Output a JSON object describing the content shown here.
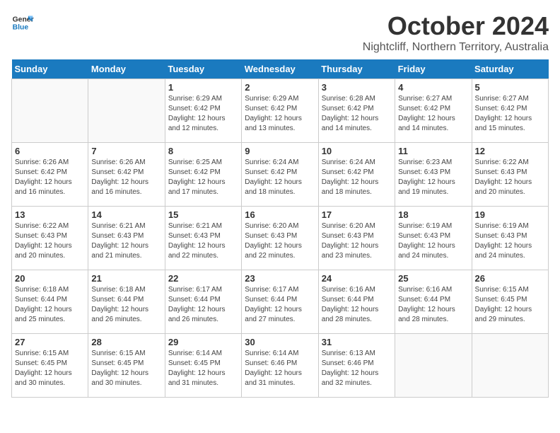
{
  "logo": {
    "line1": "General",
    "line2": "Blue"
  },
  "title": "October 2024",
  "subtitle": "Nightcliff, Northern Territory, Australia",
  "days_header": [
    "Sunday",
    "Monday",
    "Tuesday",
    "Wednesday",
    "Thursday",
    "Friday",
    "Saturday"
  ],
  "weeks": [
    [
      {
        "day": "",
        "info": ""
      },
      {
        "day": "",
        "info": ""
      },
      {
        "day": "1",
        "info": "Sunrise: 6:29 AM\nSunset: 6:42 PM\nDaylight: 12 hours\nand 12 minutes."
      },
      {
        "day": "2",
        "info": "Sunrise: 6:29 AM\nSunset: 6:42 PM\nDaylight: 12 hours\nand 13 minutes."
      },
      {
        "day": "3",
        "info": "Sunrise: 6:28 AM\nSunset: 6:42 PM\nDaylight: 12 hours\nand 14 minutes."
      },
      {
        "day": "4",
        "info": "Sunrise: 6:27 AM\nSunset: 6:42 PM\nDaylight: 12 hours\nand 14 minutes."
      },
      {
        "day": "5",
        "info": "Sunrise: 6:27 AM\nSunset: 6:42 PM\nDaylight: 12 hours\nand 15 minutes."
      }
    ],
    [
      {
        "day": "6",
        "info": "Sunrise: 6:26 AM\nSunset: 6:42 PM\nDaylight: 12 hours\nand 16 minutes."
      },
      {
        "day": "7",
        "info": "Sunrise: 6:26 AM\nSunset: 6:42 PM\nDaylight: 12 hours\nand 16 minutes."
      },
      {
        "day": "8",
        "info": "Sunrise: 6:25 AM\nSunset: 6:42 PM\nDaylight: 12 hours\nand 17 minutes."
      },
      {
        "day": "9",
        "info": "Sunrise: 6:24 AM\nSunset: 6:42 PM\nDaylight: 12 hours\nand 18 minutes."
      },
      {
        "day": "10",
        "info": "Sunrise: 6:24 AM\nSunset: 6:42 PM\nDaylight: 12 hours\nand 18 minutes."
      },
      {
        "day": "11",
        "info": "Sunrise: 6:23 AM\nSunset: 6:43 PM\nDaylight: 12 hours\nand 19 minutes."
      },
      {
        "day": "12",
        "info": "Sunrise: 6:22 AM\nSunset: 6:43 PM\nDaylight: 12 hours\nand 20 minutes."
      }
    ],
    [
      {
        "day": "13",
        "info": "Sunrise: 6:22 AM\nSunset: 6:43 PM\nDaylight: 12 hours\nand 20 minutes."
      },
      {
        "day": "14",
        "info": "Sunrise: 6:21 AM\nSunset: 6:43 PM\nDaylight: 12 hours\nand 21 minutes."
      },
      {
        "day": "15",
        "info": "Sunrise: 6:21 AM\nSunset: 6:43 PM\nDaylight: 12 hours\nand 22 minutes."
      },
      {
        "day": "16",
        "info": "Sunrise: 6:20 AM\nSunset: 6:43 PM\nDaylight: 12 hours\nand 22 minutes."
      },
      {
        "day": "17",
        "info": "Sunrise: 6:20 AM\nSunset: 6:43 PM\nDaylight: 12 hours\nand 23 minutes."
      },
      {
        "day": "18",
        "info": "Sunrise: 6:19 AM\nSunset: 6:43 PM\nDaylight: 12 hours\nand 24 minutes."
      },
      {
        "day": "19",
        "info": "Sunrise: 6:19 AM\nSunset: 6:43 PM\nDaylight: 12 hours\nand 24 minutes."
      }
    ],
    [
      {
        "day": "20",
        "info": "Sunrise: 6:18 AM\nSunset: 6:44 PM\nDaylight: 12 hours\nand 25 minutes."
      },
      {
        "day": "21",
        "info": "Sunrise: 6:18 AM\nSunset: 6:44 PM\nDaylight: 12 hours\nand 26 minutes."
      },
      {
        "day": "22",
        "info": "Sunrise: 6:17 AM\nSunset: 6:44 PM\nDaylight: 12 hours\nand 26 minutes."
      },
      {
        "day": "23",
        "info": "Sunrise: 6:17 AM\nSunset: 6:44 PM\nDaylight: 12 hours\nand 27 minutes."
      },
      {
        "day": "24",
        "info": "Sunrise: 6:16 AM\nSunset: 6:44 PM\nDaylight: 12 hours\nand 28 minutes."
      },
      {
        "day": "25",
        "info": "Sunrise: 6:16 AM\nSunset: 6:44 PM\nDaylight: 12 hours\nand 28 minutes."
      },
      {
        "day": "26",
        "info": "Sunrise: 6:15 AM\nSunset: 6:45 PM\nDaylight: 12 hours\nand 29 minutes."
      }
    ],
    [
      {
        "day": "27",
        "info": "Sunrise: 6:15 AM\nSunset: 6:45 PM\nDaylight: 12 hours\nand 30 minutes."
      },
      {
        "day": "28",
        "info": "Sunrise: 6:15 AM\nSunset: 6:45 PM\nDaylight: 12 hours\nand 30 minutes."
      },
      {
        "day": "29",
        "info": "Sunrise: 6:14 AM\nSunset: 6:45 PM\nDaylight: 12 hours\nand 31 minutes."
      },
      {
        "day": "30",
        "info": "Sunrise: 6:14 AM\nSunset: 6:46 PM\nDaylight: 12 hours\nand 31 minutes."
      },
      {
        "day": "31",
        "info": "Sunrise: 6:13 AM\nSunset: 6:46 PM\nDaylight: 12 hours\nand 32 minutes."
      },
      {
        "day": "",
        "info": ""
      },
      {
        "day": "",
        "info": ""
      }
    ]
  ]
}
